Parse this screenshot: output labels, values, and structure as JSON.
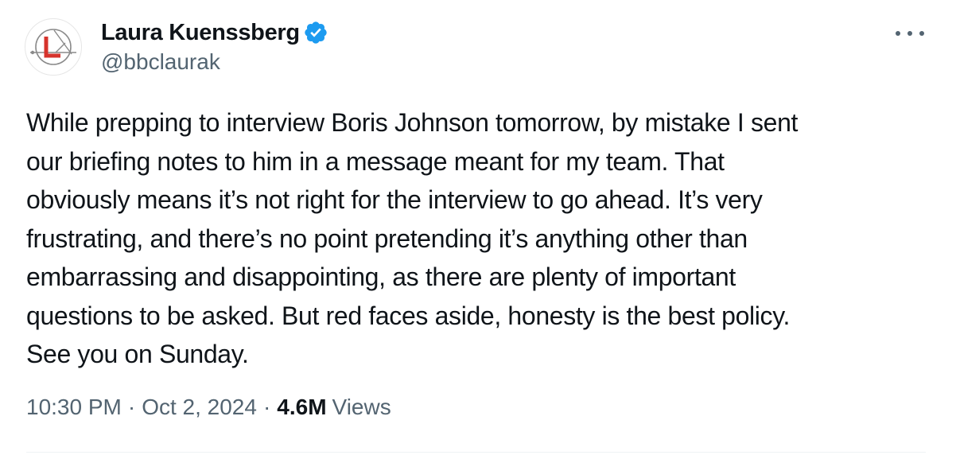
{
  "author": {
    "display_name": "Laura Kuenssberg",
    "handle": "@bbclaurak",
    "verified": true,
    "avatar_icon": "bbc-laura-kuenssberg-logo-icon",
    "verified_icon": "verified-badge-icon",
    "verified_color": "#1d9bf0"
  },
  "menu": {
    "more_icon": "more-options-icon"
  },
  "tweet": {
    "lines": [
      "While prepping to interview Boris Johnson tomorrow,  by mistake I sent",
      "our briefing notes to him in a message meant for my team. That",
      "obviously means it’s not right for the interview to go ahead. It’s very",
      "frustrating, and there’s no point pretending it’s anything other than",
      "embarrassing and disappointing, as there are plenty of important",
      "questions to be asked. But red faces aside, honesty is the best policy.",
      "See you on Sunday."
    ]
  },
  "meta": {
    "time": "10:30 PM",
    "separator": "·",
    "date": "Oct 2, 2024",
    "views_count": "4.6M",
    "views_label": "Views"
  },
  "colors": {
    "text_primary": "#0f1419",
    "text_secondary": "#536471",
    "logo_red": "#d6332c",
    "logo_gray": "#7a7a7a"
  }
}
